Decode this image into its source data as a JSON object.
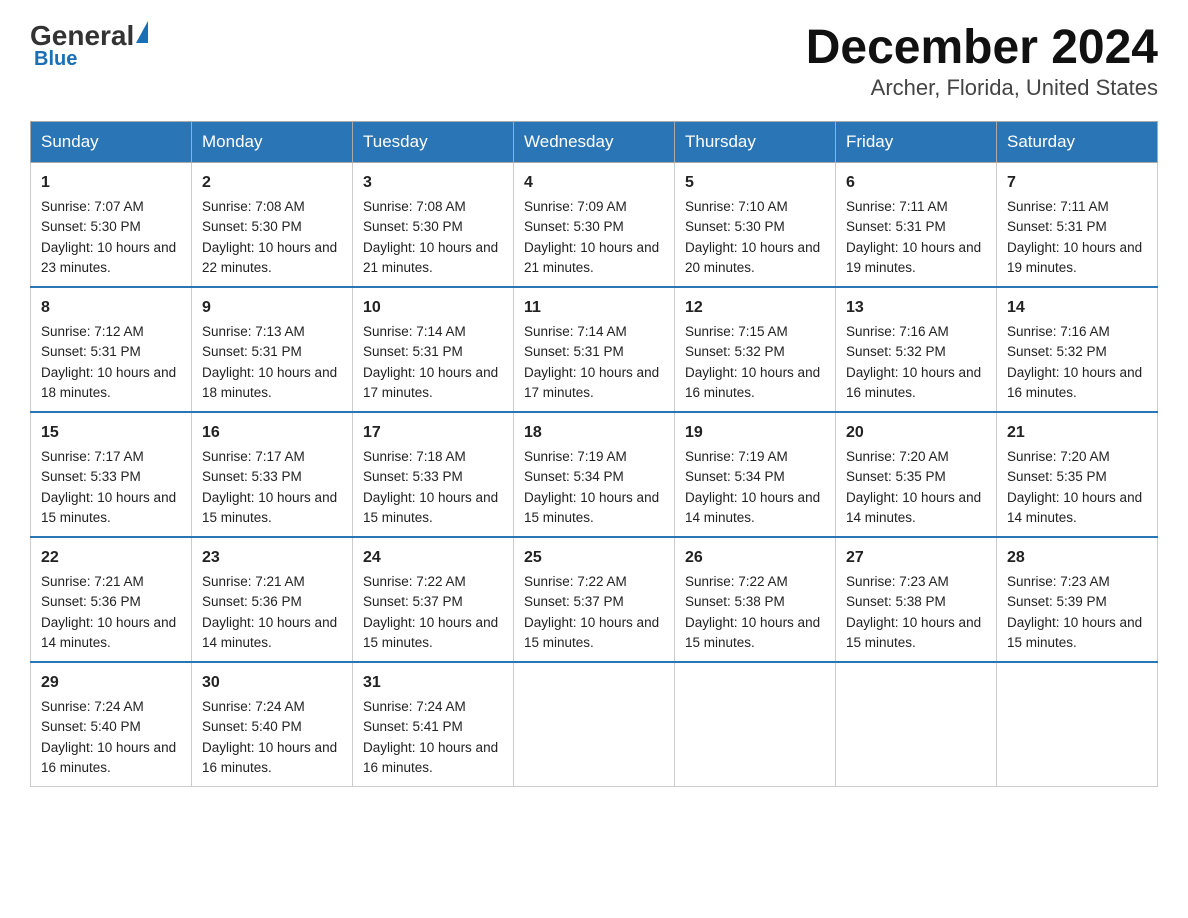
{
  "logo": {
    "general": "General",
    "blue": "Blue"
  },
  "header": {
    "month": "December 2024",
    "location": "Archer, Florida, United States"
  },
  "days_of_week": [
    "Sunday",
    "Monday",
    "Tuesday",
    "Wednesday",
    "Thursday",
    "Friday",
    "Saturday"
  ],
  "weeks": [
    [
      {
        "day": "1",
        "sunrise": "7:07 AM",
        "sunset": "5:30 PM",
        "daylight": "10 hours and 23 minutes."
      },
      {
        "day": "2",
        "sunrise": "7:08 AM",
        "sunset": "5:30 PM",
        "daylight": "10 hours and 22 minutes."
      },
      {
        "day": "3",
        "sunrise": "7:08 AM",
        "sunset": "5:30 PM",
        "daylight": "10 hours and 21 minutes."
      },
      {
        "day": "4",
        "sunrise": "7:09 AM",
        "sunset": "5:30 PM",
        "daylight": "10 hours and 21 minutes."
      },
      {
        "day": "5",
        "sunrise": "7:10 AM",
        "sunset": "5:30 PM",
        "daylight": "10 hours and 20 minutes."
      },
      {
        "day": "6",
        "sunrise": "7:11 AM",
        "sunset": "5:31 PM",
        "daylight": "10 hours and 19 minutes."
      },
      {
        "day": "7",
        "sunrise": "7:11 AM",
        "sunset": "5:31 PM",
        "daylight": "10 hours and 19 minutes."
      }
    ],
    [
      {
        "day": "8",
        "sunrise": "7:12 AM",
        "sunset": "5:31 PM",
        "daylight": "10 hours and 18 minutes."
      },
      {
        "day": "9",
        "sunrise": "7:13 AM",
        "sunset": "5:31 PM",
        "daylight": "10 hours and 18 minutes."
      },
      {
        "day": "10",
        "sunrise": "7:14 AM",
        "sunset": "5:31 PM",
        "daylight": "10 hours and 17 minutes."
      },
      {
        "day": "11",
        "sunrise": "7:14 AM",
        "sunset": "5:31 PM",
        "daylight": "10 hours and 17 minutes."
      },
      {
        "day": "12",
        "sunrise": "7:15 AM",
        "sunset": "5:32 PM",
        "daylight": "10 hours and 16 minutes."
      },
      {
        "day": "13",
        "sunrise": "7:16 AM",
        "sunset": "5:32 PM",
        "daylight": "10 hours and 16 minutes."
      },
      {
        "day": "14",
        "sunrise": "7:16 AM",
        "sunset": "5:32 PM",
        "daylight": "10 hours and 16 minutes."
      }
    ],
    [
      {
        "day": "15",
        "sunrise": "7:17 AM",
        "sunset": "5:33 PM",
        "daylight": "10 hours and 15 minutes."
      },
      {
        "day": "16",
        "sunrise": "7:17 AM",
        "sunset": "5:33 PM",
        "daylight": "10 hours and 15 minutes."
      },
      {
        "day": "17",
        "sunrise": "7:18 AM",
        "sunset": "5:33 PM",
        "daylight": "10 hours and 15 minutes."
      },
      {
        "day": "18",
        "sunrise": "7:19 AM",
        "sunset": "5:34 PM",
        "daylight": "10 hours and 15 minutes."
      },
      {
        "day": "19",
        "sunrise": "7:19 AM",
        "sunset": "5:34 PM",
        "daylight": "10 hours and 14 minutes."
      },
      {
        "day": "20",
        "sunrise": "7:20 AM",
        "sunset": "5:35 PM",
        "daylight": "10 hours and 14 minutes."
      },
      {
        "day": "21",
        "sunrise": "7:20 AM",
        "sunset": "5:35 PM",
        "daylight": "10 hours and 14 minutes."
      }
    ],
    [
      {
        "day": "22",
        "sunrise": "7:21 AM",
        "sunset": "5:36 PM",
        "daylight": "10 hours and 14 minutes."
      },
      {
        "day": "23",
        "sunrise": "7:21 AM",
        "sunset": "5:36 PM",
        "daylight": "10 hours and 14 minutes."
      },
      {
        "day": "24",
        "sunrise": "7:22 AM",
        "sunset": "5:37 PM",
        "daylight": "10 hours and 15 minutes."
      },
      {
        "day": "25",
        "sunrise": "7:22 AM",
        "sunset": "5:37 PM",
        "daylight": "10 hours and 15 minutes."
      },
      {
        "day": "26",
        "sunrise": "7:22 AM",
        "sunset": "5:38 PM",
        "daylight": "10 hours and 15 minutes."
      },
      {
        "day": "27",
        "sunrise": "7:23 AM",
        "sunset": "5:38 PM",
        "daylight": "10 hours and 15 minutes."
      },
      {
        "day": "28",
        "sunrise": "7:23 AM",
        "sunset": "5:39 PM",
        "daylight": "10 hours and 15 minutes."
      }
    ],
    [
      {
        "day": "29",
        "sunrise": "7:24 AM",
        "sunset": "5:40 PM",
        "daylight": "10 hours and 16 minutes."
      },
      {
        "day": "30",
        "sunrise": "7:24 AM",
        "sunset": "5:40 PM",
        "daylight": "10 hours and 16 minutes."
      },
      {
        "day": "31",
        "sunrise": "7:24 AM",
        "sunset": "5:41 PM",
        "daylight": "10 hours and 16 minutes."
      },
      null,
      null,
      null,
      null
    ]
  ],
  "labels": {
    "sunrise": "Sunrise: ",
    "sunset": "Sunset: ",
    "daylight": "Daylight: "
  }
}
